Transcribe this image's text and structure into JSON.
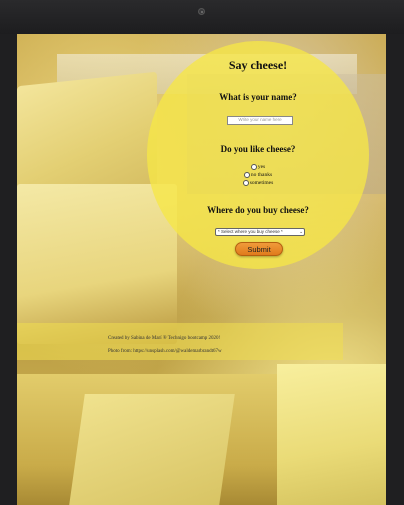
{
  "form": {
    "title": "Say cheese!",
    "name_question": "What is your name?",
    "name_placeholder": "Write your name here",
    "like_question": "Do you like cheese?",
    "like_options": [
      "yes",
      "no thanks",
      "sometimes"
    ],
    "buy_question": "Where do you buy cheese?",
    "buy_select_value": "* Select where you buy cheese *",
    "submit_label": "Submit"
  },
  "footer": {
    "credit": "Created by Sabina de Marí ® Technigo bootcamp 2020!",
    "photo": "Photo from: https://unsplash.com/@waldemarbrandt67w"
  },
  "colors": {
    "form_background": "#f6e746",
    "submit_button": "#e88a2a",
    "footer_background": "#f0de50"
  }
}
